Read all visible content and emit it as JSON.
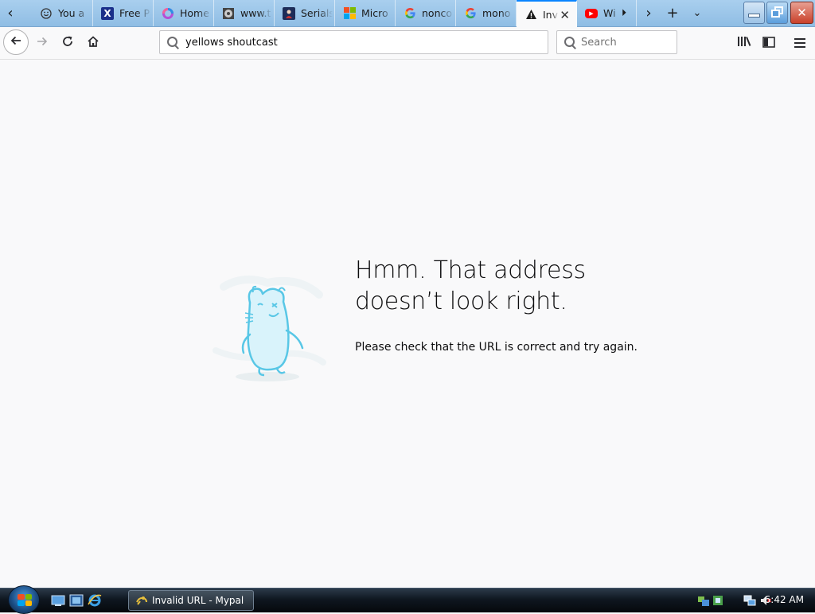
{
  "tabs": [
    {
      "title": "You a",
      "favicon": "smiley-favicon",
      "active": false
    },
    {
      "title": "Free P",
      "favicon": "x-favicon",
      "active": false
    },
    {
      "title": "Home",
      "favicon": "ring-favicon",
      "active": false
    },
    {
      "title": "www.t",
      "favicon": "disc-favicon",
      "active": false
    },
    {
      "title": "Serials",
      "favicon": "serials-favicon",
      "active": false
    },
    {
      "title": "Micro",
      "favicon": "microsoft-favicon",
      "active": false
    },
    {
      "title": "nonco",
      "favicon": "google-favicon",
      "active": false
    },
    {
      "title": "mono",
      "favicon": "google-favicon",
      "active": false
    },
    {
      "title": "Inv",
      "favicon": "warning-favicon",
      "active": true
    },
    {
      "title": "Wi",
      "favicon": "youtube-favicon",
      "active": false
    }
  ],
  "navbar": {
    "url_value": "yellows shoutcast",
    "search_placeholder": "Search"
  },
  "error_page": {
    "title": "Hmm. That address doesn’t look right.",
    "description": "Please check that the URL is correct and try again."
  },
  "taskbar": {
    "window_button_label": "Invalid URL - Mypal",
    "clock": "6:42 AM"
  },
  "colors": {
    "tab_accent": "#0a84ff",
    "page_background": "#f9f9fa",
    "illustration": "#59c7e6"
  }
}
